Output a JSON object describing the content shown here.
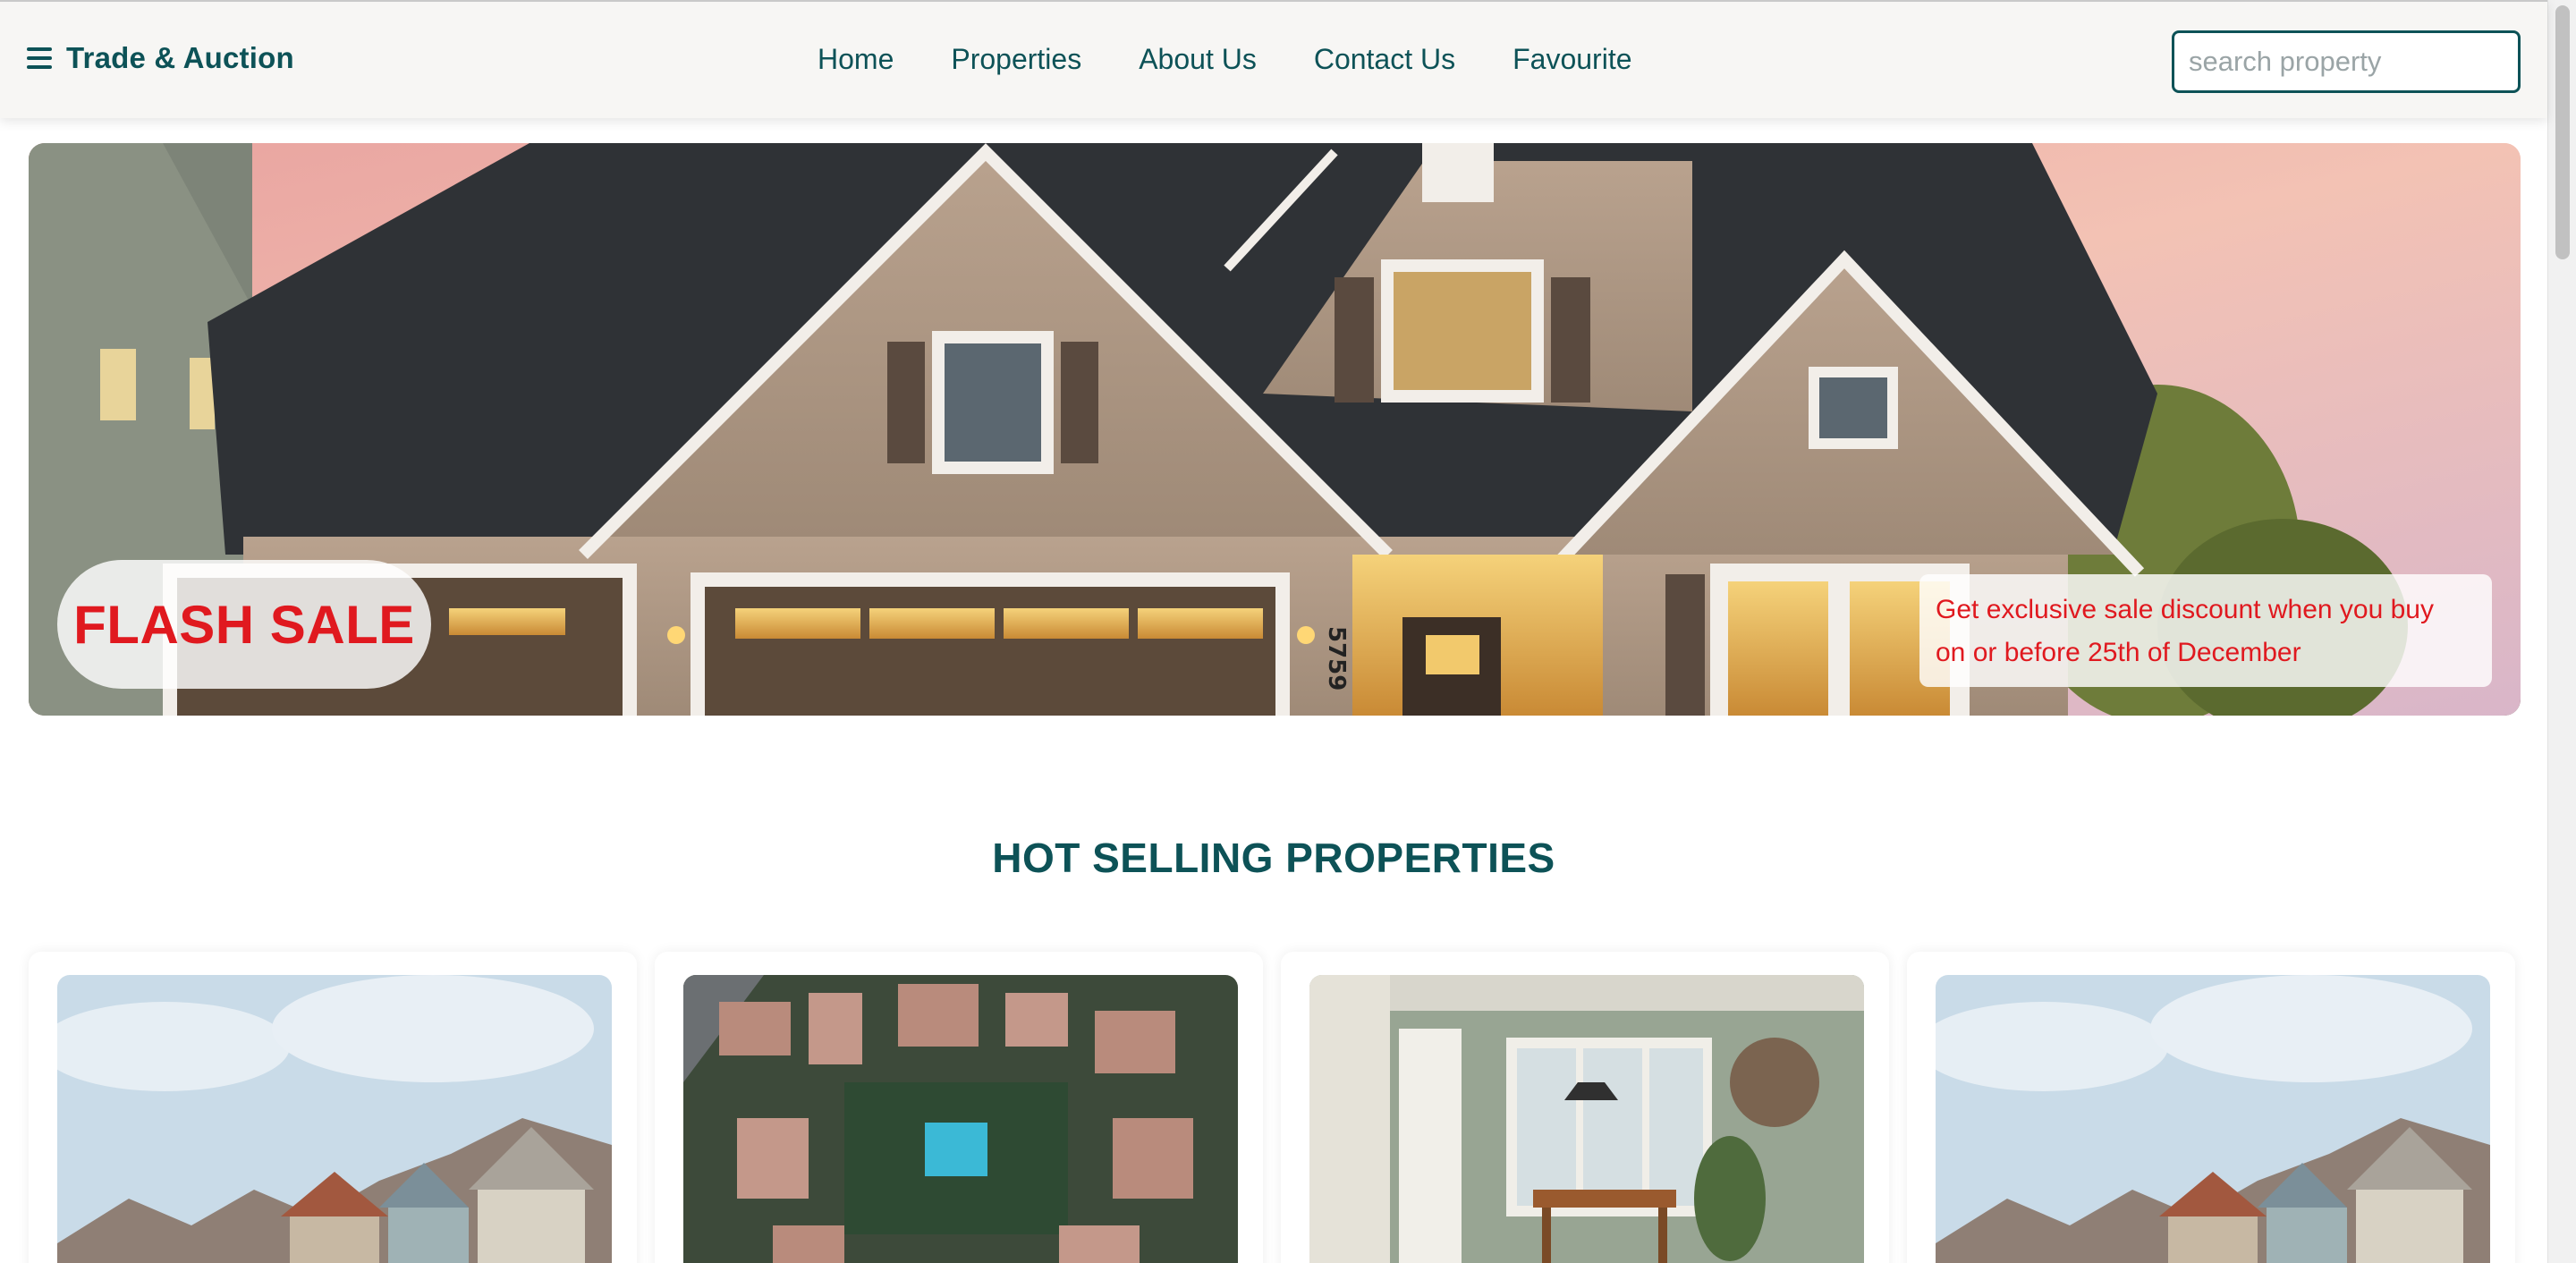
{
  "navbar": {
    "brand": "Trade & Auction",
    "links": [
      "Home",
      "Properties",
      "About Us",
      "Contact Us",
      "Favourite"
    ],
    "search_placeholder": "search property",
    "search_value": ""
  },
  "hero": {
    "badge": "FLASH SALE",
    "promo_line1": "Get exclusive sale discount when you buy",
    "promo_line2": "on or before 25th of December",
    "house_number": "5759"
  },
  "section": {
    "title": "HOT SELLING PROPERTIES"
  },
  "icons": {
    "menu": "hamburger-menu-icon"
  },
  "colors": {
    "brand": "#0d5257",
    "accent_red": "#e0191f",
    "navbar_bg": "#f7f6f4"
  }
}
